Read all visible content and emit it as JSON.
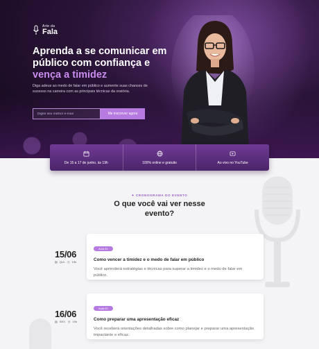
{
  "logo": {
    "small": "Arte da",
    "big": "Fala"
  },
  "hero": {
    "headline_part1": "Aprenda a se comunicar em público com confiança e",
    "headline_accent": "vença a timidez",
    "subtext": "Diga adeus ao medo de falar em público e aumente suas chances de sucesso na carreira com as principais técnicas da oratória.",
    "email_placeholder": "Digite seu melhor e-mail",
    "cta_label": "Me inscrever agora"
  },
  "infobar": [
    {
      "icon": "calendar-icon",
      "label": "De 15 a 17 de junho, às 19h"
    },
    {
      "icon": "globe-icon",
      "label": "100% online e gratuito"
    },
    {
      "icon": "play-icon",
      "label": "Ao vivo no YouTube"
    }
  ],
  "agenda": {
    "eyebrow": "✦ CRONOGRAMA DO EVENTO",
    "title": "O que você vai ver nesse evento?",
    "items": [
      {
        "date": "15/06",
        "weekday": "QUI.",
        "time": "19h",
        "tag": "Aula 01",
        "title": "Como vencer a timidez e o medo de falar em público",
        "desc": "Você aprenderá estratégias e técnicas para superar a timidez e o medo de falar em público."
      },
      {
        "date": "16/06",
        "weekday": "SEX.",
        "time": "19h",
        "tag": "Aula 02",
        "title": "Como preparar uma apresentação eficaz",
        "desc": "Você receberá orientações detalhadas sobre como planejar e preparar uma apresentação impactante e eficaz."
      }
    ]
  },
  "colors": {
    "accent": "#b67ae0",
    "hero_dark": "#1a0d24",
    "bar": "#5b2d7d"
  }
}
